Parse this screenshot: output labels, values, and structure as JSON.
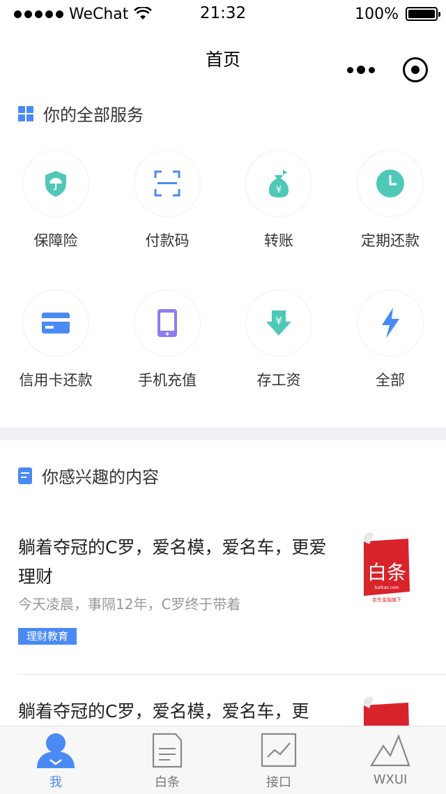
{
  "status_bar": {
    "carrier": "WeChat",
    "time": "21:32",
    "battery": "100%"
  },
  "nav": {
    "title": "首页"
  },
  "services_section": {
    "title": "你的全部服务",
    "items": [
      {
        "label": "保障险",
        "icon": "shield-umbrella-icon",
        "color": "#4fc8b8"
      },
      {
        "label": "付款码",
        "icon": "scan-code-icon",
        "color": "#4a8af4"
      },
      {
        "label": "转账",
        "icon": "money-bag-icon",
        "color": "#4fc8b8"
      },
      {
        "label": "定期还款",
        "icon": "clock-icon",
        "color": "#4fc8b8"
      },
      {
        "label": "信用卡还款",
        "icon": "credit-card-icon",
        "color": "#4a8af4"
      },
      {
        "label": "手机充值",
        "icon": "mobile-phone-icon",
        "color": "#8e7cf0"
      },
      {
        "label": "存工资",
        "icon": "yen-down-icon",
        "color": "#4fc8b8"
      },
      {
        "label": "全部",
        "icon": "lightning-icon",
        "color": "#4a8af4"
      }
    ]
  },
  "content_section": {
    "title": "你感兴趣的内容",
    "articles": [
      {
        "title": "躺着夺冠的C罗，爱名模，爱名车，更爱理财",
        "desc": "今天凌晨，事隔12年，C罗终于带着",
        "tag": "理财教育",
        "thumb_text": "白条",
        "thumb_sub": "baitiao.com",
        "thumb_caption": "京东金融旗下"
      },
      {
        "title": "躺着夺冠的C罗，爱名模，爱名车，更"
      }
    ]
  },
  "tab_bar": {
    "tabs": [
      {
        "label": "我",
        "icon": "user-icon",
        "active": true
      },
      {
        "label": "白条",
        "icon": "document-icon",
        "active": false
      },
      {
        "label": "接口",
        "icon": "chart-icon",
        "active": false
      },
      {
        "label": "WXUI",
        "icon": "mountain-icon",
        "active": false
      }
    ]
  },
  "colors": {
    "accent": "#4a8af4",
    "teal": "#4fc8b8",
    "purple": "#8e7cf0",
    "brand_red": "#d9232a"
  }
}
